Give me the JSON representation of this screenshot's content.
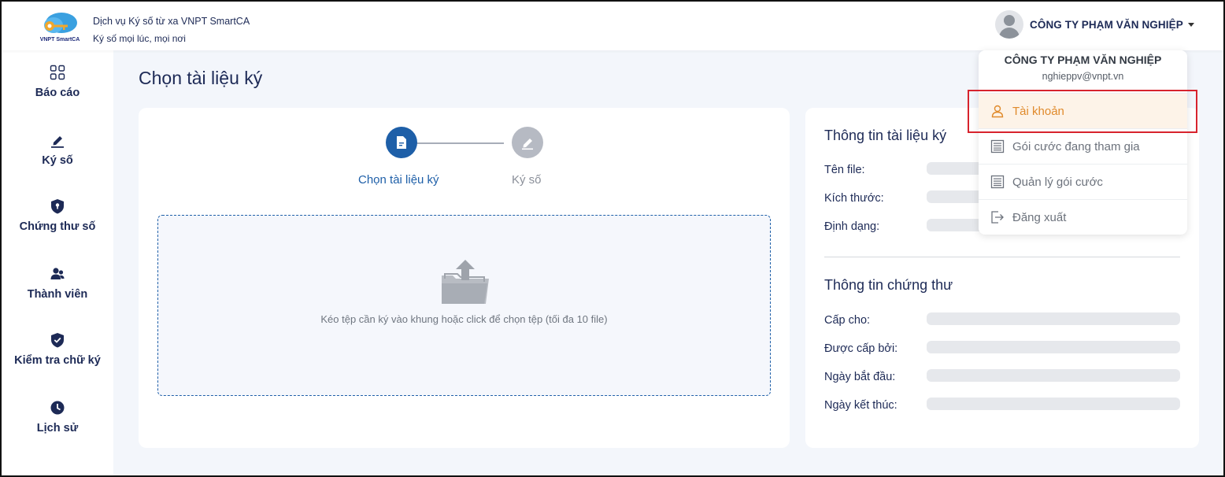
{
  "header": {
    "brand_title": "Dịch vụ Ký số từ xa VNPT SmartCA",
    "brand_subtitle": "Ký số mọi lúc, mọi nơi",
    "logo_text": "VNPT SmartCA",
    "user_name": "CÔNG TY PHẠM VĂN NGHIỆP"
  },
  "sidebar": {
    "items": [
      {
        "label": "Báo cáo",
        "icon": "grid-icon"
      },
      {
        "label": "Ký số",
        "icon": "pen-icon"
      },
      {
        "label": "Chứng thư số",
        "icon": "shield-lock-icon"
      },
      {
        "label": "Thành viên",
        "icon": "users-icon"
      },
      {
        "label": "Kiểm tra chữ ký",
        "icon": "shield-check-icon"
      },
      {
        "label": "Lịch sử",
        "icon": "clock-icon"
      }
    ]
  },
  "main": {
    "page_title": "Chọn tài liệu ký",
    "steps": [
      {
        "label": "Chọn tài liệu ký",
        "active": true
      },
      {
        "label": "Ký số",
        "active": false
      }
    ],
    "dropzone_text": "Kéo tệp cần ký vào khung hoặc click để chọn tệp (tối đa 10 file)"
  },
  "doc_info": {
    "title": "Thông tin tài liệu ký",
    "fields": [
      "Tên file:",
      "Kích thước:",
      "Định dạng:"
    ]
  },
  "cert_info": {
    "title": "Thông tin chứng thư",
    "fields": [
      "Cấp cho:",
      "Được cấp bởi:",
      "Ngày bắt đầu:",
      "Ngày kết thúc:"
    ]
  },
  "dropdown": {
    "name": "CÔNG TY PHẠM VĂN NGHIỆP",
    "email": "nghieppv@vnpt.vn",
    "items": [
      {
        "label": "Tài khoản",
        "icon": "user-icon",
        "active": true
      },
      {
        "label": "Gói cước đang tham gia",
        "icon": "list-doc-icon",
        "active": false
      },
      {
        "label": "Quản lý gói cước",
        "icon": "list-doc-icon",
        "active": false
      },
      {
        "label": "Đăng xuất",
        "icon": "logout-icon",
        "active": false
      }
    ]
  },
  "colors": {
    "primary": "#1e5fa8",
    "accent_orange": "#e08a2b",
    "highlight_red": "#d7232d",
    "background": "#f3f6fb"
  }
}
